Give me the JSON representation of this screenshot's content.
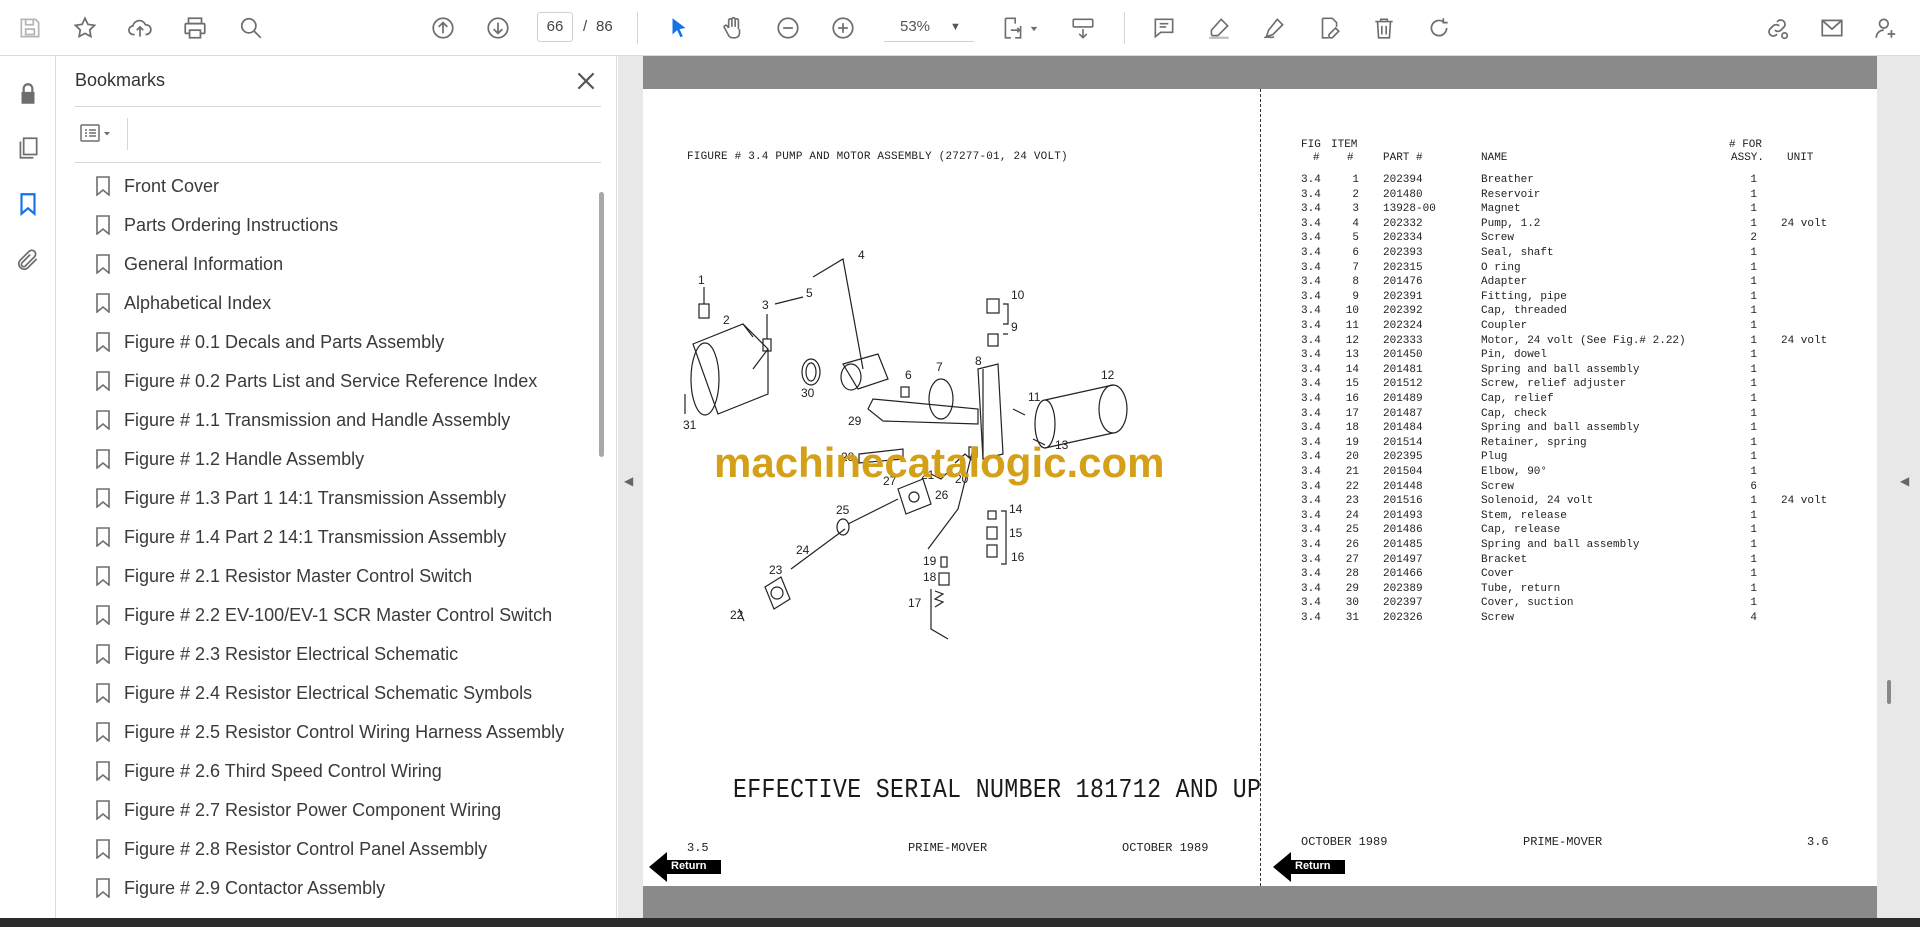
{
  "toolbar": {
    "current_page": "66",
    "page_separator": "/",
    "total_pages": "86",
    "zoom": "53%"
  },
  "bookmarks": {
    "title": "Bookmarks",
    "items": [
      {
        "label": "Front Cover"
      },
      {
        "label": "Parts Ordering Instructions"
      },
      {
        "label": "General Information"
      },
      {
        "label": "Alphabetical Index"
      },
      {
        "label": "Figure # 0.1 Decals and Parts Assembly"
      },
      {
        "label": "Figure # 0.2 Parts List and Service Reference Index"
      },
      {
        "label": "Figure # 1.1 Transmission and Handle Assembly"
      },
      {
        "label": "Figure # 1.2 Handle Assembly"
      },
      {
        "label": "Figure # 1.3 Part 1 14:1 Transmission Assembly"
      },
      {
        "label": "Figure # 1.4 Part 2 14:1 Transmission Assembly"
      },
      {
        "label": "Figure # 2.1 Resistor Master Control Switch"
      },
      {
        "label": "Figure # 2.2 EV-100/EV-1 SCR Master Control Switch"
      },
      {
        "label": "Figure # 2.3 Resistor Electrical Schematic"
      },
      {
        "label": "Figure # 2.4 Resistor Electrical Schematic Symbols"
      },
      {
        "label": "Figure # 2.5 Resistor Control Wiring Harness Assembly"
      },
      {
        "label": "Figure # 2.6 Third Speed Control Wiring"
      },
      {
        "label": "Figure # 2.7 Resistor Power Component Wiring"
      },
      {
        "label": "Figure # 2.8 Resistor Control Panel Assembly"
      },
      {
        "label": "Figure # 2.9 Contactor Assembly"
      }
    ]
  },
  "document": {
    "left_page": {
      "figure_title": "FIGURE # 3.4 PUMP AND MOTOR ASSEMBLY (27277-01, 24 VOLT)",
      "effective_serial": "EFFECTIVE SERIAL NUMBER 181712 AND UP",
      "page_number": "3.5",
      "footer_center": "PRIME-MOVER",
      "footer_date": "OCTOBER 1989",
      "return_label": "Return",
      "callouts": [
        "1",
        "2",
        "3",
        "4",
        "5",
        "6",
        "7",
        "8",
        "9",
        "10",
        "11",
        "12",
        "13",
        "14",
        "15",
        "16",
        "17",
        "18",
        "19",
        "20",
        "21",
        "22",
        "23",
        "24",
        "25",
        "26",
        "27",
        "28",
        "29",
        "30",
        "31"
      ]
    },
    "watermark": "machinecatalogic.com",
    "right_page": {
      "headers": {
        "fig_top": "FIG",
        "fig_bottom": "#",
        "item_top": "ITEM",
        "item_bottom": "#",
        "part": "PART #",
        "name": "NAME",
        "qty_top": "# FOR",
        "qty_bottom": "ASSY.",
        "unit": "UNIT"
      },
      "rows": [
        {
          "fig": "3.4",
          "item": "1",
          "part": "202394",
          "name": "Breather",
          "qty": "1",
          "unit": ""
        },
        {
          "fig": "3.4",
          "item": "2",
          "part": "201480",
          "name": "Reservoir",
          "qty": "1",
          "unit": ""
        },
        {
          "fig": "3.4",
          "item": "3",
          "part": "13928-00",
          "name": "Magnet",
          "qty": "1",
          "unit": ""
        },
        {
          "fig": "3.4",
          "item": "4",
          "part": "202332",
          "name": "Pump, 1.2",
          "qty": "1",
          "unit": "24 volt"
        },
        {
          "fig": "3.4",
          "item": "5",
          "part": "202334",
          "name": "Screw",
          "qty": "2",
          "unit": ""
        },
        {
          "fig": "3.4",
          "item": "6",
          "part": "202393",
          "name": "Seal, shaft",
          "qty": "1",
          "unit": ""
        },
        {
          "fig": "3.4",
          "item": "7",
          "part": "202315",
          "name": "O ring",
          "qty": "1",
          "unit": ""
        },
        {
          "fig": "3.4",
          "item": "8",
          "part": "201476",
          "name": "Adapter",
          "qty": "1",
          "unit": ""
        },
        {
          "fig": "3.4",
          "item": "9",
          "part": "202391",
          "name": "Fitting, pipe",
          "qty": "1",
          "unit": ""
        },
        {
          "fig": "3.4",
          "item": "10",
          "part": "202392",
          "name": "Cap, threaded",
          "qty": "1",
          "unit": ""
        },
        {
          "fig": "3.4",
          "item": "11",
          "part": "202324",
          "name": "Coupler",
          "qty": "1",
          "unit": ""
        },
        {
          "fig": "3.4",
          "item": "12",
          "part": "202333",
          "name": "Motor, 24 volt (See Fig.# 2.22)",
          "qty": "1",
          "unit": "24 volt"
        },
        {
          "fig": "3.4",
          "item": "13",
          "part": "201450",
          "name": "Pin, dowel",
          "qty": "1",
          "unit": ""
        },
        {
          "fig": "3.4",
          "item": "14",
          "part": "201481",
          "name": "Spring and ball assembly",
          "qty": "1",
          "unit": ""
        },
        {
          "fig": "3.4",
          "item": "15",
          "part": "201512",
          "name": "Screw, relief adjuster",
          "qty": "1",
          "unit": ""
        },
        {
          "fig": "3.4",
          "item": "16",
          "part": "201489",
          "name": "Cap, relief",
          "qty": "1",
          "unit": ""
        },
        {
          "fig": "3.4",
          "item": "17",
          "part": "201487",
          "name": "Cap, check",
          "qty": "1",
          "unit": ""
        },
        {
          "fig": "3.4",
          "item": "18",
          "part": "201484",
          "name": "Spring and ball assembly",
          "qty": "1",
          "unit": ""
        },
        {
          "fig": "3.4",
          "item": "19",
          "part": "201514",
          "name": "Retainer, spring",
          "qty": "1",
          "unit": ""
        },
        {
          "fig": "3.4",
          "item": "20",
          "part": "202395",
          "name": "Plug",
          "qty": "1",
          "unit": ""
        },
        {
          "fig": "3.4",
          "item": "21",
          "part": "201504",
          "name": "Elbow, 90°",
          "qty": "1",
          "unit": ""
        },
        {
          "fig": "3.4",
          "item": "22",
          "part": "201448",
          "name": "Screw",
          "qty": "6",
          "unit": ""
        },
        {
          "fig": "3.4",
          "item": "23",
          "part": "201516",
          "name": "Solenoid, 24 volt",
          "qty": "1",
          "unit": "24 volt"
        },
        {
          "fig": "3.4",
          "item": "24",
          "part": "201493",
          "name": "Stem, release",
          "qty": "1",
          "unit": ""
        },
        {
          "fig": "3.4",
          "item": "25",
          "part": "201486",
          "name": "Cap, release",
          "qty": "1",
          "unit": ""
        },
        {
          "fig": "3.4",
          "item": "26",
          "part": "201485",
          "name": "Spring and ball assembly",
          "qty": "1",
          "unit": ""
        },
        {
          "fig": "3.4",
          "item": "27",
          "part": "201497",
          "name": "Bracket",
          "qty": "1",
          "unit": ""
        },
        {
          "fig": "3.4",
          "item": "28",
          "part": "201466",
          "name": "Cover",
          "qty": "1",
          "unit": ""
        },
        {
          "fig": "3.4",
          "item": "29",
          "part": "202389",
          "name": "Tube, return",
          "qty": "1",
          "unit": ""
        },
        {
          "fig": "3.4",
          "item": "30",
          "part": "202397",
          "name": "Cover, suction",
          "qty": "1",
          "unit": ""
        },
        {
          "fig": "3.4",
          "item": "31",
          "part": "202326",
          "name": "Screw",
          "qty": "4",
          "unit": ""
        }
      ],
      "footer_date": "OCTOBER 1989",
      "footer_center": "PRIME-MOVER",
      "page_number": "3.6",
      "return_label": "Return"
    }
  },
  "colors": {
    "accent": "#1473e6",
    "watermark": "#d4a017",
    "icon": "#6e6e6e"
  }
}
